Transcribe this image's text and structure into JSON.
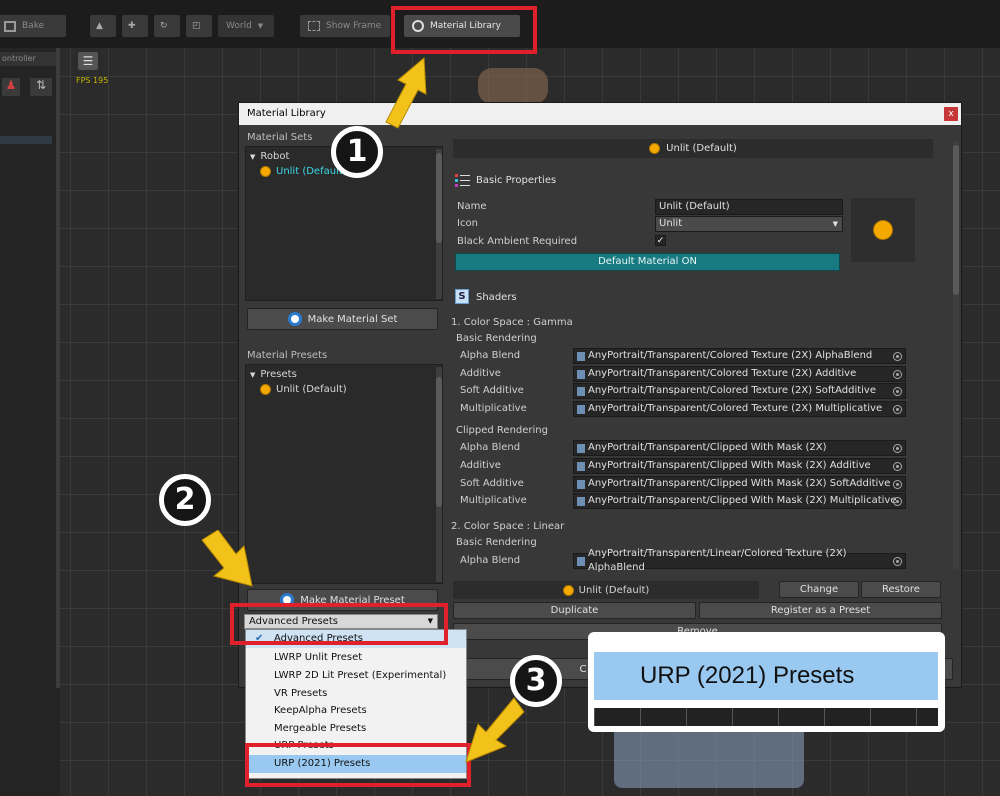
{
  "toolbar": {
    "bake_label": "Bake",
    "world_label": "World",
    "show_frame_label": "Show Frame",
    "material_library_label": "Material Library"
  },
  "left_panel": {
    "controller_label": "ontroller"
  },
  "viewport": {
    "fps_label": "FPS 195"
  },
  "window": {
    "title": "Material Library",
    "close": "x",
    "material_sets_label": "Material Sets",
    "sets_tree": {
      "root": "Robot",
      "item": "Unlit (Default)"
    },
    "make_set_button": "Make Material Set",
    "material_presets_label": "Material Presets",
    "presets_tree": {
      "root": "Presets",
      "item": "Unlit (Default)"
    },
    "make_preset_button": "Make Material Preset",
    "header_title": "Unlit (Default)",
    "basic_properties_label": "Basic Properties",
    "name_label": "Name",
    "name_value": "Unlit (Default)",
    "icon_label": "Icon",
    "icon_value": "Unlit",
    "black_ambient_label": "Black Ambient Required",
    "default_material_button": "Default Material ON",
    "shaders_label": "Shaders",
    "gamma_label": "1. Color Space : Gamma",
    "linear_label": "2. Color Space : Linear",
    "basic_rendering_label": "Basic Rendering",
    "clipped_rendering_label": "Clipped Rendering",
    "gamma_basic": [
      {
        "label": "Alpha Blend",
        "value": "AnyPortrait/Transparent/Colored Texture (2X) AlphaBlend"
      },
      {
        "label": "Additive",
        "value": "AnyPortrait/Transparent/Colored Texture (2X) Additive"
      },
      {
        "label": "Soft Additive",
        "value": "AnyPortrait/Transparent/Colored Texture (2X) SoftAdditive"
      },
      {
        "label": "Multiplicative",
        "value": "AnyPortrait/Transparent/Colored Texture (2X) Multiplicative"
      }
    ],
    "gamma_clipped": [
      {
        "label": "Alpha Blend",
        "value": "AnyPortrait/Transparent/Clipped With Mask (2X)"
      },
      {
        "label": "Additive",
        "value": "AnyPortrait/Transparent/Clipped With Mask (2X) Additive"
      },
      {
        "label": "Soft Additive",
        "value": "AnyPortrait/Transparent/Clipped With Mask (2X) SoftAdditive"
      },
      {
        "label": "Multiplicative",
        "value": "AnyPortrait/Transparent/Clipped With Mask (2X) Multiplicative"
      }
    ],
    "linear_basic": [
      {
        "label": "Alpha Blend",
        "value": "AnyPortrait/Transparent/Linear/Colored Texture (2X) AlphaBlend"
      }
    ],
    "footer_material": "Unlit (Default)",
    "change_button": "Change",
    "restore_button": "Restore",
    "duplicate_button": "Duplicate",
    "register_button": "Register as a Preset",
    "remove_button": "Remove",
    "partial_button": "C"
  },
  "dropdown": {
    "selected": "Advanced Presets",
    "options": [
      "Advanced Presets",
      "LWRP Unlit Preset",
      "LWRP 2D Lit Preset (Experimental)",
      "VR Presets",
      "KeepAlpha Presets",
      "Mergeable Presets",
      "URP Presets",
      "URP (2021) Presets"
    ]
  },
  "callouts": {
    "step1": "1",
    "step2": "2",
    "step3": "3",
    "zoom_text": "URP (2021) Presets",
    "accent_red": "#e0212b",
    "arrow_yellow": "#f2c21a"
  }
}
